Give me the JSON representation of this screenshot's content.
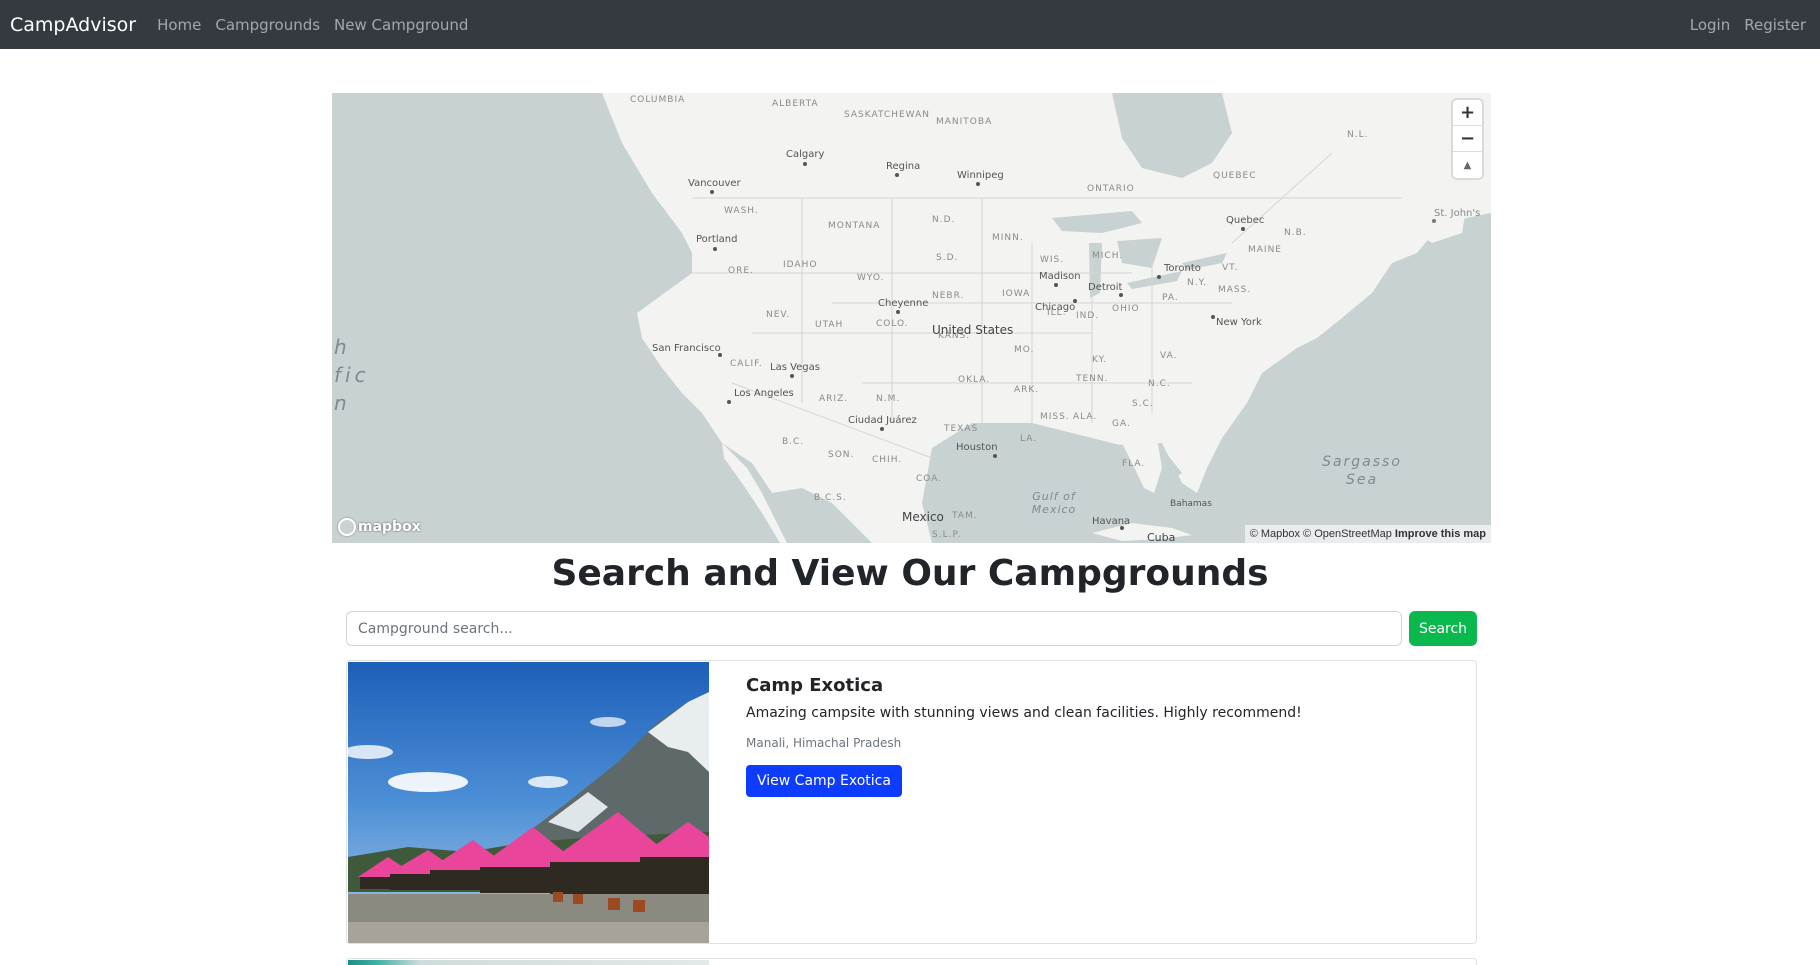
{
  "navbar": {
    "brand": "CampAdvisor",
    "links": [
      "Home",
      "Campgrounds",
      "New Campground"
    ],
    "auth": [
      "Login",
      "Register"
    ]
  },
  "map": {
    "states": [
      "COLUMBIA",
      "ALBERTA",
      "SASKATCHEWAN",
      "MANITOBA",
      "ONTARIO",
      "QUEBEC",
      "N.L.",
      "N.B.",
      "MAINE",
      "WASH.",
      "MONTANA",
      "N.D.",
      "MINN.",
      "ORE.",
      "IDAHO",
      "WYO.",
      "S.D.",
      "WIS.",
      "MICH.",
      "N.Y.",
      "VT.",
      "MASS.",
      "NEV.",
      "UTAH",
      "COLO.",
      "NEBR.",
      "IOWA",
      "ILL.",
      "IND.",
      "OHIO",
      "PA.",
      "CALIF.",
      "ARIZ.",
      "N.M.",
      "OKLA.",
      "KANS.",
      "MO.",
      "KY.",
      "VA.",
      "TENN.",
      "N.C.",
      "S.C.",
      "ARK.",
      "MISS.",
      "ALA.",
      "GA.",
      "TEXAS",
      "LA.",
      "FLA.",
      "SON.",
      "CHIH.",
      "COA.",
      "B.C.",
      "B.C.S.",
      "TAM.",
      "S.L.P."
    ],
    "cities": [
      "Calgary",
      "Regina",
      "Winnipeg",
      "Vancouver",
      "Portland",
      "Quebec",
      "St. John's",
      "Toronto",
      "Madison",
      "Detroit",
      "Chicago",
      "Cheyenne",
      "New York",
      "San Francisco",
      "Las Vegas",
      "Los Angeles",
      "Ciudad Juárez",
      "Houston",
      "Havana",
      "Bahamas"
    ],
    "countries": [
      "United States",
      "Mexico",
      "Cuba"
    ],
    "seas": [
      "Sargasso Sea",
      "Gulf of Mexico"
    ],
    "ocean_partial": "h fic n",
    "zoom_in": "+",
    "zoom_out": "−",
    "compass": "▲",
    "logo": "mapbox",
    "attribution": {
      "text": "© Mapbox © OpenStreetMap",
      "improve": "Improve this map"
    },
    "colors": {
      "water": "#c8d2d2",
      "land": "#f3f3f1"
    }
  },
  "heading": "Search and View Our Campgrounds",
  "search": {
    "placeholder": "Campground search...",
    "button": "Search",
    "button_color": "#0bb84d"
  },
  "campgrounds": [
    {
      "title": "Camp Exotica",
      "description": "Amazing campsite with stunning views and clean facilities. Highly recommend!",
      "location": "Manali, Himachal Pradesh",
      "button": "View Camp Exotica",
      "button_color": "#0d3cff"
    }
  ]
}
